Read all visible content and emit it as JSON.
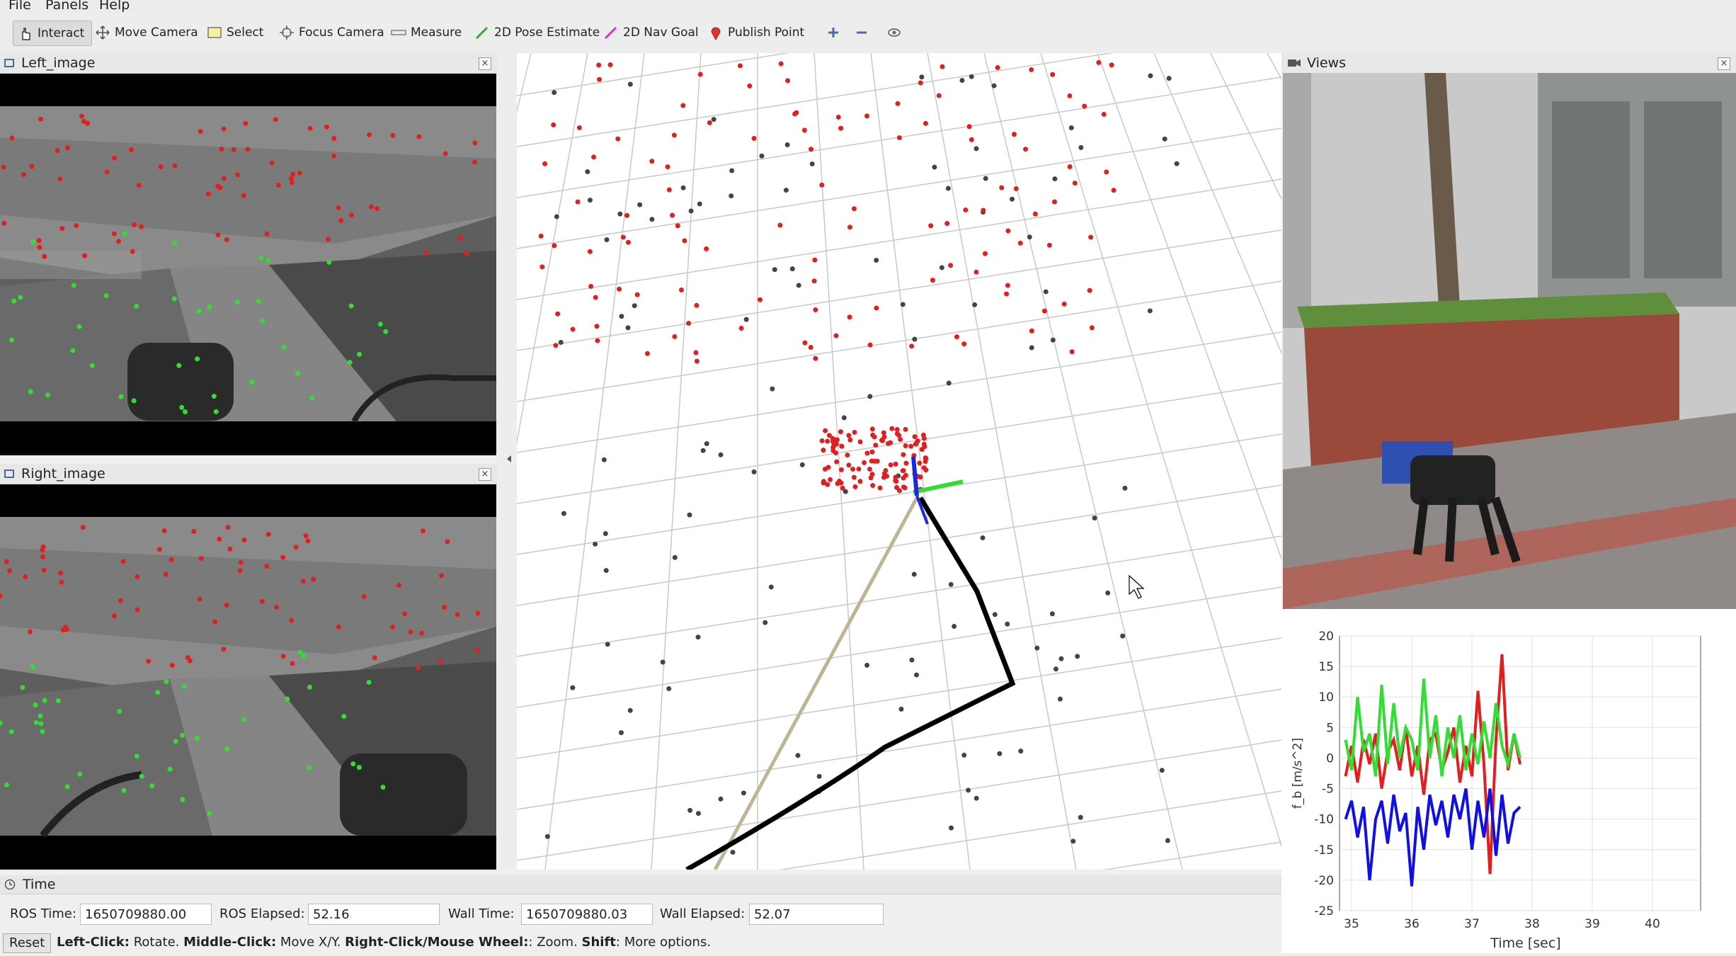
{
  "menu": {
    "file": "File",
    "panels": "Panels",
    "help": "Help"
  },
  "toolbar": {
    "interact": "Interact",
    "move_camera": "Move Camera",
    "select": "Select",
    "focus_camera": "Focus Camera",
    "measure": "Measure",
    "pose_estimate": "2D Pose Estimate",
    "nav_goal": "2D Nav Goal",
    "publish_point": "Publish Point"
  },
  "left_panel": {
    "title": "Left_image"
  },
  "right_panel": {
    "title": "Right_image"
  },
  "views_panel": {
    "title": "Views"
  },
  "time_panel": {
    "title": "Time",
    "ros_time_label": "ROS Time:",
    "ros_time": "1650709880.00",
    "ros_elapsed_label": "ROS Elapsed:",
    "ros_elapsed": "52.16",
    "wall_time_label": "Wall Time:",
    "wall_time": "1650709880.03",
    "wall_elapsed_label": "Wall Elapsed:",
    "wall_elapsed": "52.07"
  },
  "status": {
    "reset": "Reset",
    "left_click": "Left-Click:",
    "left_click_desc": " Rotate. ",
    "middle_click": "Middle-Click:",
    "middle_click_desc": " Move X/Y. ",
    "right_click": "Right-Click/Mouse Wheel:",
    "right_click_desc": ": Zoom. ",
    "shift": "Shift",
    "shift_desc": ": More options."
  },
  "colors": {
    "red_feature": "#e02020",
    "green_feature": "#33dd33",
    "trajectory": "#000000",
    "gt_line": "#b8b090"
  },
  "chart_data": {
    "type": "line",
    "xlabel": "Time [sec]",
    "ylabel": "f_b [m/s^2]",
    "xlim": [
      34.8,
      40.8
    ],
    "ylim": [
      -25,
      20
    ],
    "xticks": [
      "35",
      "36",
      "37",
      "38",
      "39",
      "40"
    ],
    "yticks": [
      "20",
      "15",
      "10",
      "5",
      "0",
      "-5",
      "-10",
      "-15",
      "-20",
      "-25"
    ],
    "grid": true,
    "series": [
      {
        "color": "#e02020",
        "x": [
          34.9,
          35.0,
          35.1,
          35.2,
          35.3,
          35.4,
          35.5,
          35.6,
          35.7,
          35.8,
          35.9,
          36.0,
          36.1,
          36.2,
          36.3,
          36.4,
          36.5,
          36.6,
          36.7,
          36.8,
          36.9,
          37.0,
          37.1,
          37.2,
          37.3,
          37.4,
          37.5,
          37.6,
          37.7,
          37.8
        ],
        "y": [
          -3,
          2,
          -4,
          3,
          -1,
          4,
          -5,
          1,
          3,
          -2,
          5,
          -3,
          2,
          -6,
          3,
          4,
          -2,
          1,
          5,
          -4,
          2,
          -3,
          11,
          -1,
          -19,
          3,
          17,
          -2,
          4,
          -1
        ]
      },
      {
        "color": "#33dd33",
        "x": [
          34.9,
          35.0,
          35.1,
          35.2,
          35.3,
          35.4,
          35.5,
          35.6,
          35.7,
          35.8,
          35.9,
          36.0,
          36.1,
          36.2,
          36.3,
          36.4,
          36.5,
          36.6,
          36.7,
          36.8,
          36.9,
          37.0,
          37.1,
          37.2,
          37.3,
          37.4,
          37.5,
          37.6,
          37.7,
          37.8
        ],
        "y": [
          3,
          -2,
          10,
          1,
          4,
          -3,
          12,
          -1,
          9,
          0,
          5,
          3,
          -2,
          13,
          0,
          7,
          -3,
          5,
          0,
          7,
          -2,
          4,
          -1,
          6,
          0,
          9,
          2,
          -1,
          4,
          0
        ]
      },
      {
        "color": "#1010e0",
        "x": [
          34.9,
          35.0,
          35.1,
          35.2,
          35.3,
          35.4,
          35.5,
          35.6,
          35.7,
          35.8,
          35.9,
          36.0,
          36.1,
          36.2,
          36.3,
          36.4,
          36.5,
          36.6,
          36.7,
          36.8,
          36.9,
          37.0,
          37.1,
          37.2,
          37.3,
          37.4,
          37.5,
          37.6,
          37.7,
          37.8
        ],
        "y": [
          -10,
          -7,
          -13,
          -8,
          -20,
          -10,
          -7,
          -14,
          -6,
          -12,
          -9,
          -21,
          -8,
          -15,
          -6,
          -11,
          -7,
          -13,
          -6,
          -10,
          -5,
          -15,
          -7,
          -13,
          -5,
          -16,
          -6,
          -14,
          -9,
          -8
        ]
      }
    ]
  }
}
